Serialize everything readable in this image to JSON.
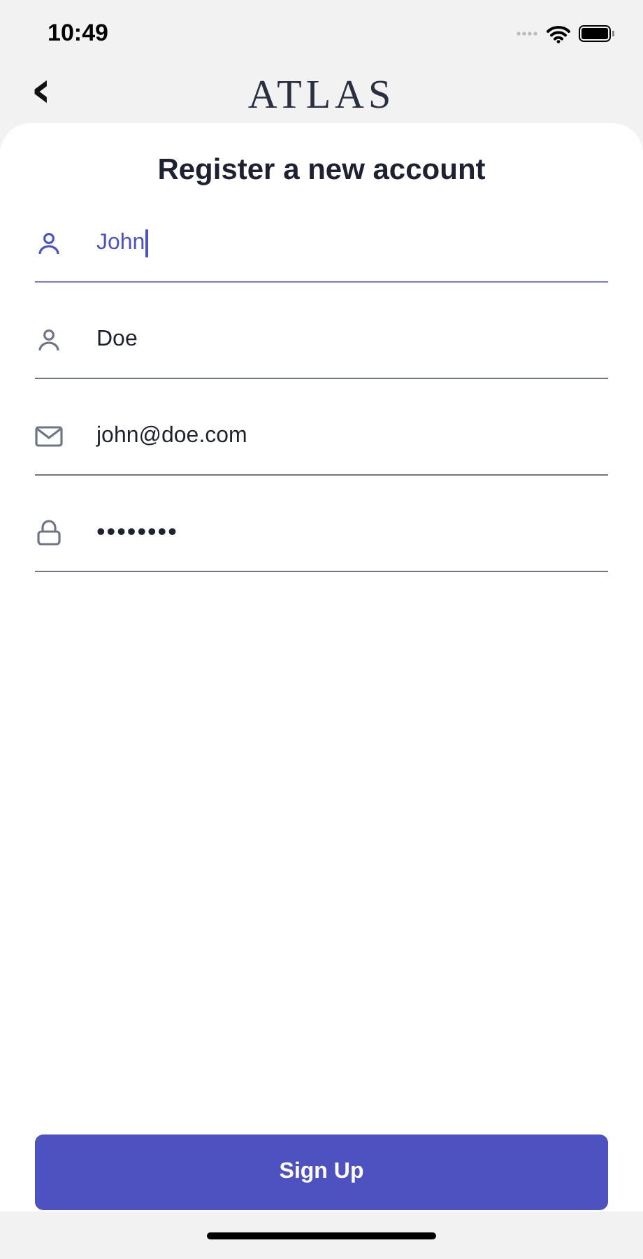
{
  "status_bar": {
    "time": "10:49"
  },
  "header": {
    "back": "‹",
    "logo": "ATLAS"
  },
  "title": "Register a new account",
  "fields": [
    {
      "kind": "person",
      "value": "John",
      "focused": true
    },
    {
      "kind": "person",
      "value": "Doe",
      "focused": false
    },
    {
      "kind": "mail",
      "value": "john@doe.com",
      "focused": false
    },
    {
      "kind": "lock",
      "value": "••••••••",
      "focused": false
    }
  ],
  "button": "Sign Up"
}
